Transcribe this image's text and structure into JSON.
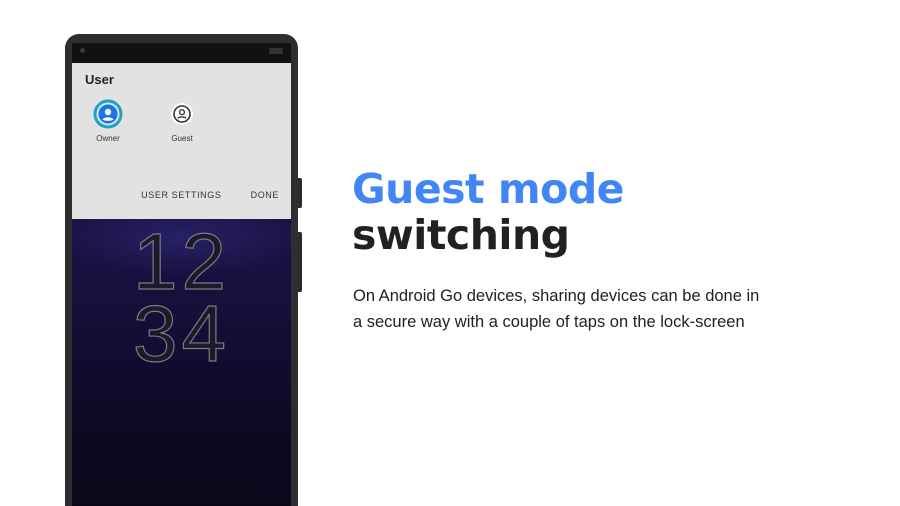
{
  "phone": {
    "user_panel": {
      "title": "User",
      "users": [
        {
          "label": "Owner",
          "icon": "account-circle-icon",
          "active": true
        },
        {
          "label": "Guest",
          "icon": "account-circle-icon",
          "active": false
        }
      ],
      "user_settings_label": "USER SETTINGS",
      "done_label": "DONE"
    },
    "clock": {
      "hours": "12",
      "minutes": "34"
    }
  },
  "content": {
    "headline_line1": "Guest mode",
    "headline_line2": "switching",
    "body_line1": "On Android Go devices, sharing devices can be done in",
    "body_line2": "a secure way with a couple of taps on the lock-screen"
  },
  "colors": {
    "accent_blue": "#4285f4",
    "owner_ring": "#1aa3c8",
    "owner_icon": "#1a73e8",
    "text_dark": "#202124"
  }
}
